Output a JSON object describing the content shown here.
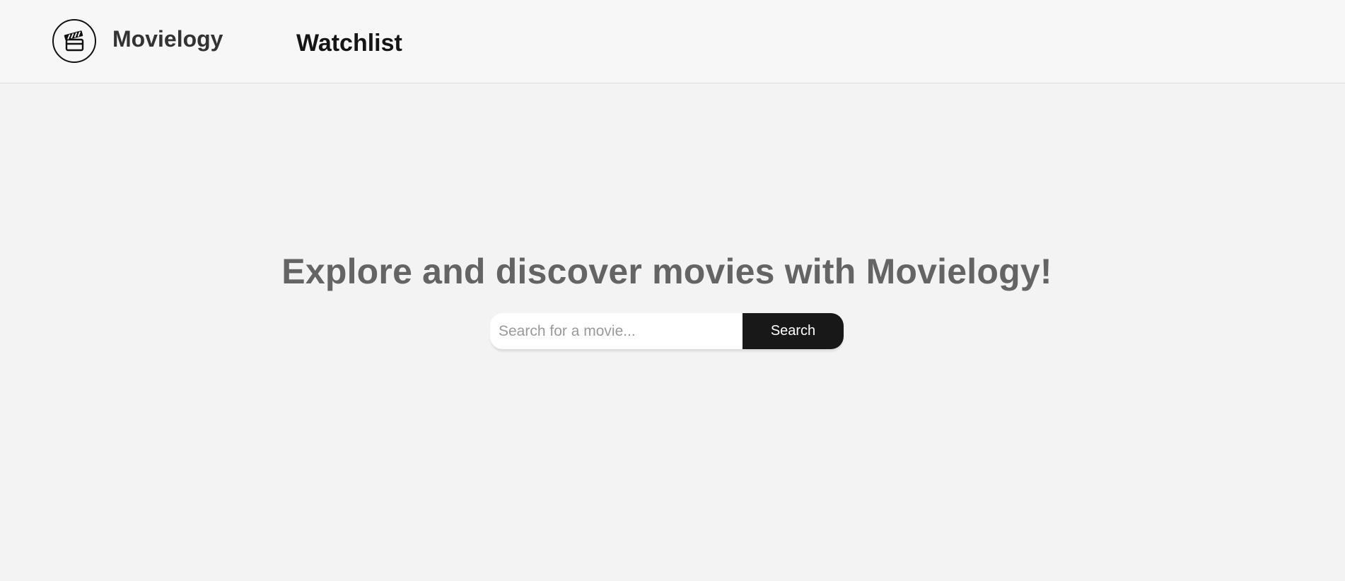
{
  "header": {
    "brand_name": "Movielogy",
    "logo_icon": "clapperboard-icon",
    "nav": {
      "watchlist_label": "Watchlist"
    }
  },
  "hero": {
    "title": "Explore and discover movies with Movielogy!"
  },
  "search": {
    "placeholder": "Search for a movie...",
    "value": "",
    "button_label": "Search"
  },
  "colors": {
    "page_background": "#f3f3f3",
    "header_background": "#f7f7f7",
    "title_text": "#646464",
    "button_background": "#181818",
    "button_text": "#ffffff"
  }
}
